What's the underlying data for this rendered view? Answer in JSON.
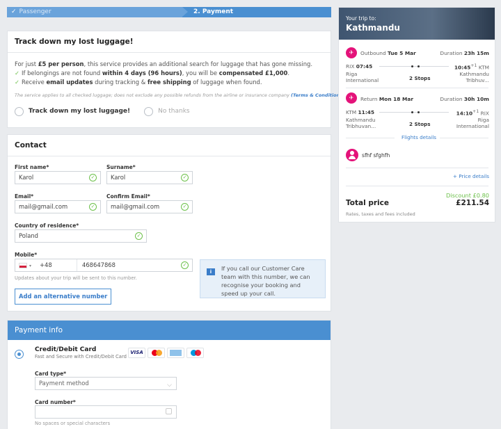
{
  "progress": {
    "step1": "Passenger",
    "step2": "2. Payment"
  },
  "luggage": {
    "title": "Track down my lost luggage!",
    "line1_pre": "For just ",
    "line1_bold": "£5 per person",
    "line1_post": ", this service provides an additional search for luggage that has gone missing.",
    "line2_pre": "If belongings are not found ",
    "line2_bold": "within 4 days (96 hours)",
    "line2_mid": ", you will be ",
    "line2_bold2": "compensated £1,000",
    "line2_post": ".",
    "line3_pre": "Receive ",
    "line3_bold": "email updates",
    "line3_mid": " during tracking & ",
    "line3_bold2": "free shipping",
    "line3_post": " of luggage when found.",
    "note": "The service applies to all checked luggage; does not exclude any possible refunds from the airline or insurance company",
    "note_link": "(Terms & Conditions)",
    "option_yes": "Track down my lost luggage!",
    "option_no": "No thanks"
  },
  "contact": {
    "title": "Contact",
    "first_name_label": "First name*",
    "first_name": "Karol",
    "surname_label": "Surname*",
    "surname": "Karol",
    "email_label": "Email*",
    "email": "mail@gmail.com",
    "confirm_email_label": "Confirm Email*",
    "confirm_email": "mail@gmail.com",
    "country_label": "Country of residence*",
    "country": "Poland",
    "mobile_label": "Mobile*",
    "dial_code": "+48",
    "mobile": "468647868",
    "mobile_help": "Updates about your trip will be sent to this number.",
    "add_number": "Add an alternative number",
    "info": "If you call our Customer Care team with this number, we can recognise your booking and speed up your call."
  },
  "payment": {
    "title": "Payment info",
    "method_title": "Credit/Debit Card",
    "method_sub": "Fast and Secure with Credit/Debit Card",
    "logos": [
      "VISA",
      "MC",
      "AMEX",
      "MAESTRO"
    ],
    "card_type_label": "Card type*",
    "card_type_placeholder": "Payment method",
    "card_number_label": "Card number*",
    "card_number_help": "No spaces or special characters"
  },
  "summary": {
    "your_trip": "Your trip to:",
    "city": "Kathmandu",
    "outbound": {
      "label": "Outbound",
      "date": "Tue 5 Mar",
      "duration_label": "Duration",
      "duration": "23h 15m",
      "dep_code": "RIX",
      "dep_time": "07:45",
      "dep_city1": "Riga",
      "dep_city2": "International",
      "stops": "2 Stops",
      "arr_time": "10:45",
      "arr_plus": "+1",
      "arr_code": "KTM",
      "arr_city1": "Kathmandu",
      "arr_city2": "Tribhuv..."
    },
    "return": {
      "label": "Return",
      "date": "Mon 18 Mar",
      "duration_label": "Duration",
      "duration": "30h 10m",
      "dep_code": "KTM",
      "dep_time": "11:45",
      "dep_city1": "Kathmandu",
      "dep_city2": "Tribhuvan...",
      "stops": "2 Stops",
      "arr_time": "14:10",
      "arr_plus": "+1",
      "arr_code": "RIX",
      "arr_city1": "Riga",
      "arr_city2": "International"
    },
    "flights_details": "Flights details",
    "passenger": "sfhf sfghfh",
    "price_details": "+ Price details",
    "discount": "Discount £0.80",
    "total_label": "Total price",
    "total": "£211.54",
    "rates_note": "Rates, taxes and fees included"
  },
  "colors": {
    "primary": "#4a8fd1",
    "accent": "#e4137a",
    "success": "#6cc04a"
  }
}
